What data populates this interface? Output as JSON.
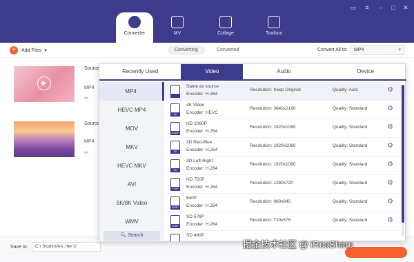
{
  "nav": {
    "tabs": [
      {
        "label": "Converter",
        "icon": "converter-icon"
      },
      {
        "label": "MV",
        "icon": "mv-icon"
      },
      {
        "label": "Collage",
        "icon": "collage-icon"
      },
      {
        "label": "Toolbox",
        "icon": "toolbox-icon"
      }
    ]
  },
  "toolbar": {
    "add_files": "Add Files",
    "converting": "Converting",
    "converted": "Converted",
    "convert_all_label": "Convert All to:",
    "convert_all_value": "MP4"
  },
  "files": [
    {
      "source": "Source",
      "format": "MP4"
    },
    {
      "source": "Source",
      "format": "MP4"
    }
  ],
  "popup": {
    "tabs": [
      "Recently Used",
      "Video",
      "Audio",
      "Device"
    ],
    "formats": [
      "MP4",
      "HEVC MP4",
      "MOV",
      "MKV",
      "HEVC MKV",
      "AVI",
      "5K/8K Video",
      "WMV"
    ],
    "search": "Search",
    "presets": [
      {
        "name": "Same as source",
        "encoder": "Encoder: H.264",
        "resolution": "Resolution: Keep Original",
        "quality": "Quality: Auto",
        "tag": ""
      },
      {
        "name": "4K Video",
        "encoder": "Encoder: HEVC",
        "resolution": "Resolution: 3840x2160",
        "quality": "Quality: Standard",
        "tag": "4K"
      },
      {
        "name": "HD 1080P",
        "encoder": "Encoder: H.264",
        "resolution": "Resolution: 1920x1080",
        "quality": "Quality: Standard",
        "tag": "1080P"
      },
      {
        "name": "3D Red-Blue",
        "encoder": "Encoder: H.264",
        "resolution": "Resolution: 1920x1080",
        "quality": "Quality: Standard",
        "tag": "3D"
      },
      {
        "name": "3D Left-Right",
        "encoder": "Encoder: H.264",
        "resolution": "Resolution: 1920x1080",
        "quality": "Quality: Standard",
        "tag": "3D"
      },
      {
        "name": "HD 720P",
        "encoder": "Encoder: H.264",
        "resolution": "Resolution: 1280x720",
        "quality": "Quality: Standard",
        "tag": "720P"
      },
      {
        "name": "640P",
        "encoder": "Encoder: H.264",
        "resolution": "Resolution: 960x640",
        "quality": "Quality: Standard",
        "tag": "640P"
      },
      {
        "name": "SD 576P",
        "encoder": "Encoder: H.264",
        "resolution": "Resolution: 720x576",
        "quality": "Quality: Standard",
        "tag": "576P"
      },
      {
        "name": "SD 480P",
        "encoder": "",
        "resolution": "",
        "quality": "",
        "tag": ""
      }
    ]
  },
  "saveto": {
    "label": "Save to:",
    "path": "C:\\          Studio\\Ars..rter U"
  },
  "watermark": "掘金技术社区 @ iReaShare"
}
